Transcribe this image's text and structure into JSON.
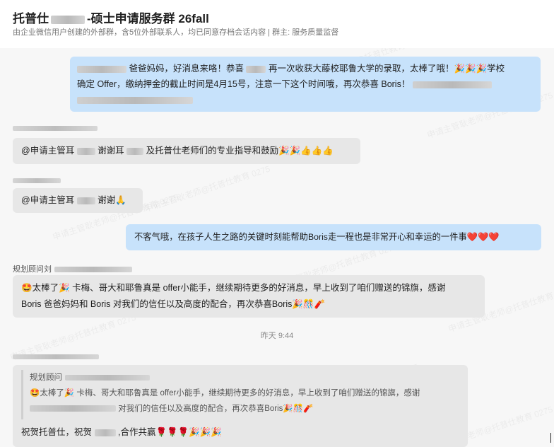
{
  "header": {
    "title_prefix": "托普仕",
    "title_suffix": "-硕士申请服务群 26fall",
    "subtitle": "由企业微信用户创建的外部群，含5位外部联系人，均已同意存档会话内容 | 群主: 服务质量监督"
  },
  "watermark": "申请主管耿老师@托普仕教育 0275",
  "messages": {
    "m1": {
      "line1_a": "爸爸妈妈，好消息来咯！恭喜",
      "line1_b": "再一次收获大藤校耶鲁大学的录取，太棒了哦！🎉🎉🎉学校",
      "line2": "确定 Offer，缴纳押金的截止时间是4月15号，注意一下这个时间哦，再次恭喜 Boris！"
    },
    "m2": {
      "a": "@申请主管耳",
      "b": "谢谢耳",
      "c": "及托普仕老师们的专业指导和鼓励🎉🎉👍👍👍"
    },
    "m3": {
      "a": "@申请主管耳",
      "b": "谢谢🙏"
    },
    "m4": {
      "text": "不客气哦，在孩子人生之路的关键时刻能帮助Boris走一程也是非常开心和幸运的一件事❤️❤️❤️"
    },
    "m5": {
      "sender": "规划顾问刘",
      "line1": "🤩太棒了🎉 卡梅、哥大和耶鲁真是 offer小能手，继续期待更多的好消息，早上收到了咱们赠送的锦旗，感谢",
      "line2": "Boris 爸爸妈妈和 Boris 对我们的信任以及高度的配合，再次恭喜Boris🎉🎊🧨"
    },
    "timestamp": "昨天 9:44",
    "m6": {
      "quote_sender": "规划顾问",
      "quote_line1": "🤩太棒了🎉 卡梅、哥大和耶鲁真是 offer小能手，继续期待更多的好消息，早上收到了咱们赠送的锦旗，感谢",
      "quote_line2": "对我们的信任以及高度的配合，再次恭喜Boris🎉🎊🧨",
      "reply_a": "祝贺托普仕，祝贺",
      "reply_b": ",合作共赢🌹🌹🌹🎉🎉🎉"
    }
  }
}
